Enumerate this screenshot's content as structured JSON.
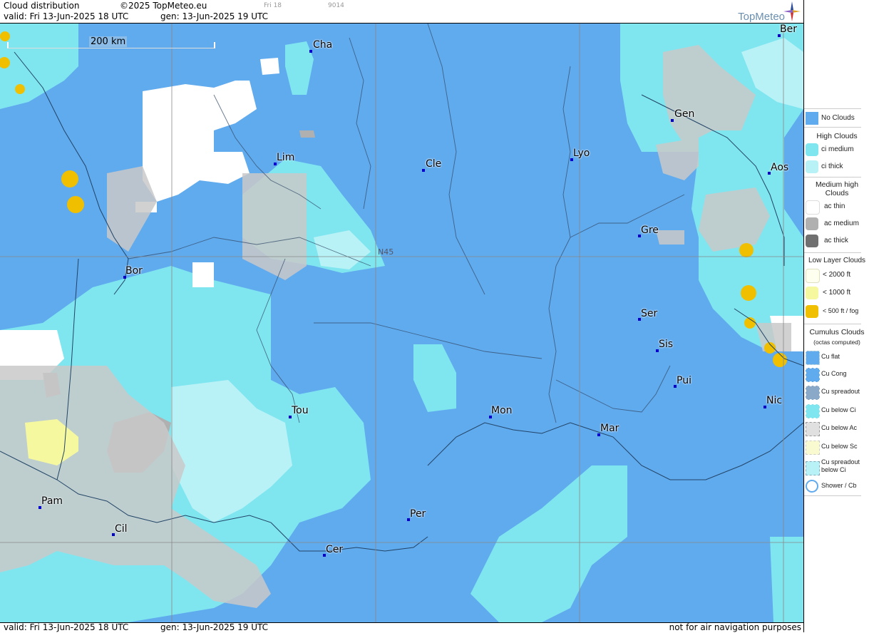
{
  "header": {
    "title": "Cloud distribution",
    "copyright": "©2025 TopMeteo.eu",
    "valid": "valid:  Fri  13-Jun-2025  18 UTC",
    "gen": "gen: 13-Jun-2025 19 UTC",
    "small_left": "Fri 18",
    "small_right": "9014",
    "logo": "TopMeteo"
  },
  "footer": {
    "valid": "valid:  Fri  13-Jun-2025  18 UTC",
    "gen": "gen: 13-Jun-2025 19 UTC",
    "disclaimer": "not for air navigation purposes"
  },
  "map": {
    "scale_label": "200 km",
    "grid_label": "N45",
    "cities": [
      {
        "name": "Cha"
      },
      {
        "name": "Ber"
      },
      {
        "name": "Gen"
      },
      {
        "name": "Lim"
      },
      {
        "name": "Cle"
      },
      {
        "name": "Lyo"
      },
      {
        "name": "Aos"
      },
      {
        "name": "Gre"
      },
      {
        "name": "Bor"
      },
      {
        "name": "Ser"
      },
      {
        "name": "Sis"
      },
      {
        "name": "Pui"
      },
      {
        "name": "Tou"
      },
      {
        "name": "Mon"
      },
      {
        "name": "Mar"
      },
      {
        "name": "Nic"
      },
      {
        "name": "Pam"
      },
      {
        "name": "Per"
      },
      {
        "name": "Cil"
      },
      {
        "name": "Cer"
      }
    ],
    "colors": {
      "no_clouds": "#60aaee",
      "ci_medium": "#7fe6f0",
      "ci_thick": "#b8f2f6",
      "ac_thin": "#ffffff",
      "ac_medium": "#b0b0b0",
      "ac_thick": "#707070",
      "low_2000": "#fffff0",
      "low_1000": "#f6f8a0",
      "low_500": "#f0c000"
    }
  },
  "legend": {
    "no_clouds": "No Clouds",
    "high_head": "High Clouds",
    "ci_medium": "ci medium",
    "ci_thick": "ci thick",
    "medium_head": "Medium high Clouds",
    "ac_thin": "ac thin",
    "ac_medium": "ac medium",
    "ac_thick": "ac thick",
    "low_head": "Low Layer Clouds",
    "low_2000": "< 2000 ft",
    "low_1000": "< 1000 ft",
    "low_500": "< 500 ft / fog",
    "cu_head": "Cumulus Clouds",
    "cu_sub": "(octas computed)",
    "cu_flat": "Cu flat",
    "cu_cong": "Cu Cong",
    "cu_spread": "Cu spreadout",
    "cu_below_ci": "Cu below Ci",
    "cu_below_ac": "Cu below Ac",
    "cu_below_sc": "Cu below Sc",
    "cu_spread_ci": "Cu spreadout below Ci",
    "shower": "Shower / Cb"
  }
}
